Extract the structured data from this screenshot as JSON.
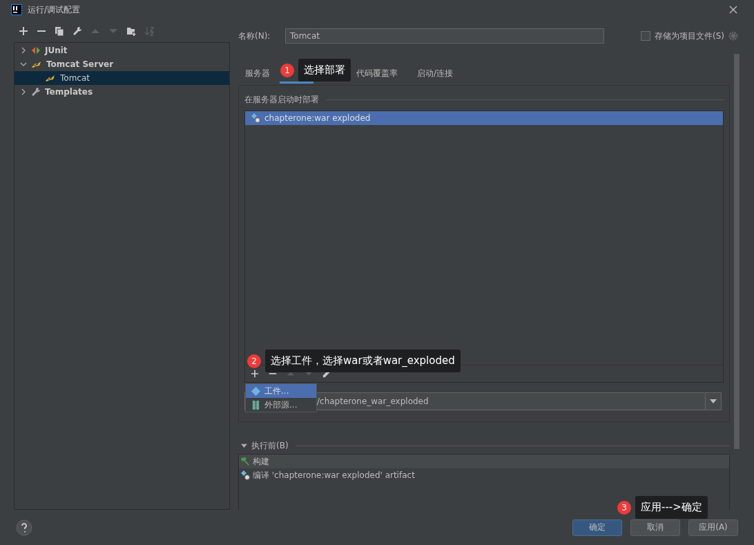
{
  "window": {
    "title": "运行/调试配置"
  },
  "toolbar": [
    {
      "kind": "add",
      "disabled": false
    },
    {
      "kind": "remove",
      "disabled": false
    },
    {
      "kind": "copy",
      "disabled": false
    },
    {
      "kind": "wrench",
      "disabled": false
    },
    {
      "kind": "up",
      "disabled": true
    },
    {
      "kind": "down",
      "disabled": true
    },
    {
      "kind": "folder",
      "disabled": false
    },
    {
      "kind": "sort",
      "disabled": true
    }
  ],
  "tree": [
    {
      "label": "JUnit",
      "kind": "junit",
      "expanded": false,
      "selected": false
    },
    {
      "label": "Tomcat Server",
      "kind": "tomcat",
      "expanded": true,
      "selected": false,
      "children": [
        {
          "label": "Tomcat",
          "kind": "tomcat",
          "selected": true
        }
      ]
    },
    {
      "label": "Templates",
      "kind": "wrench",
      "expanded": false,
      "selected": false
    }
  ],
  "name_field": {
    "label": "名称(N):",
    "value": "Tomcat"
  },
  "store_checkbox": {
    "label": "存储为项目文件(S)",
    "checked": false
  },
  "tabs": [
    {
      "label": "服务器",
      "selected": false
    },
    {
      "selected": true
    },
    {
      "label": "代码覆盖率",
      "selected": false
    },
    {
      "label": "启动/连接",
      "selected": false
    }
  ],
  "deploy": {
    "title": "在服务器启动时部署",
    "items": [
      {
        "label": "chapterone:war exploded",
        "selected": true
      }
    ],
    "list_toolbar": [
      {
        "kind": "add",
        "disabled": false
      },
      {
        "kind": "remove",
        "disabled": false
      },
      {
        "kind": "up",
        "disabled": true
      },
      {
        "kind": "down",
        "disabled": true
      },
      {
        "kind": "edit",
        "disabled": false
      }
    ],
    "popup": [
      {
        "label": "工件...",
        "kind": "artifact",
        "selected": true
      },
      {
        "label": "外部源...",
        "kind": "external",
        "selected": false
      }
    ],
    "context_value": "/chapterone_war_exploded"
  },
  "before_launch": {
    "title": "执行前(B)",
    "expanded": true,
    "items": [
      {
        "label": "构建",
        "kind": "build",
        "selected": true
      },
      {
        "label": "编译 'chapterone:war exploded' artifact",
        "kind": "artifact",
        "selected": false
      }
    ]
  },
  "buttons": [
    {
      "label": "确定",
      "kind": "primary"
    },
    {
      "label": "取消",
      "kind": "normal"
    },
    {
      "label": "应用(A)",
      "kind": "normal"
    }
  ],
  "callouts": [
    {
      "number": "1",
      "text": "选择部署"
    },
    {
      "number": "2",
      "text": "选择工件，选择war或者war_exploded"
    },
    {
      "number": "3",
      "text": "应用--->确定"
    }
  ]
}
